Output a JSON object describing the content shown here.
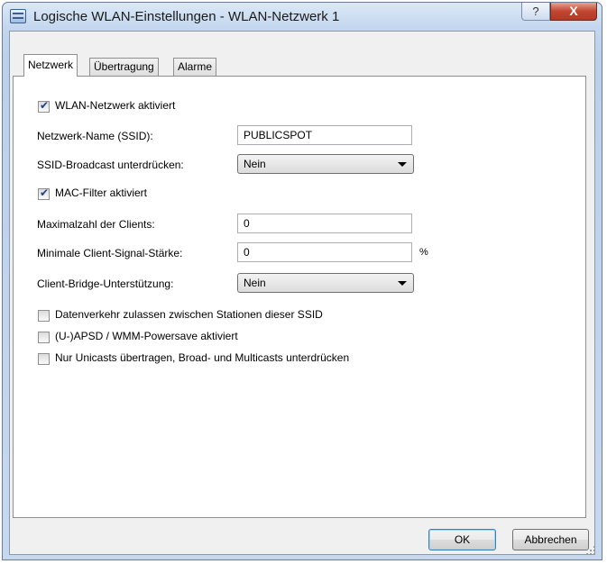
{
  "window": {
    "title": "Logische WLAN-Einstellungen - WLAN-Netzwerk 1",
    "help_glyph": "?",
    "close_glyph": "X"
  },
  "tabs": [
    {
      "label": "Netzwerk",
      "active": true
    },
    {
      "label": "Übertragung",
      "active": false
    },
    {
      "label": "Alarme",
      "active": false
    }
  ],
  "form": {
    "wlan_active": {
      "label": "WLAN-Netzwerk aktiviert",
      "checked": true
    },
    "ssid": {
      "label": "Netzwerk-Name (SSID):",
      "value": "PUBLICSPOT"
    },
    "ssid_broadcast": {
      "label": "SSID-Broadcast unterdrücken:",
      "value": "Nein"
    },
    "mac_filter": {
      "label": "MAC-Filter aktiviert",
      "checked": true
    },
    "max_clients": {
      "label": "Maximalzahl der Clients:",
      "value": "0"
    },
    "min_signal": {
      "label": "Minimale Client-Signal-Stärke:",
      "value": "0",
      "unit": "%"
    },
    "client_bridge": {
      "label": "Client-Bridge-Unterstützung:",
      "value": "Nein"
    },
    "inter_station": {
      "label": "Datenverkehr zulassen zwischen Stationen dieser SSID",
      "checked": false
    },
    "uapsd": {
      "label": "(U-)APSD / WMM-Powersave aktiviert",
      "checked": false
    },
    "unicast_only": {
      "label": "Nur Unicasts übertragen, Broad- und Multicasts unterdrücken",
      "checked": false
    }
  },
  "buttons": {
    "ok": "OK",
    "cancel": "Abbrechen"
  },
  "colors": {
    "check_mark": "#1e3f8a",
    "close_button": "#c2452f",
    "title_bar": "#c3d6ee"
  }
}
